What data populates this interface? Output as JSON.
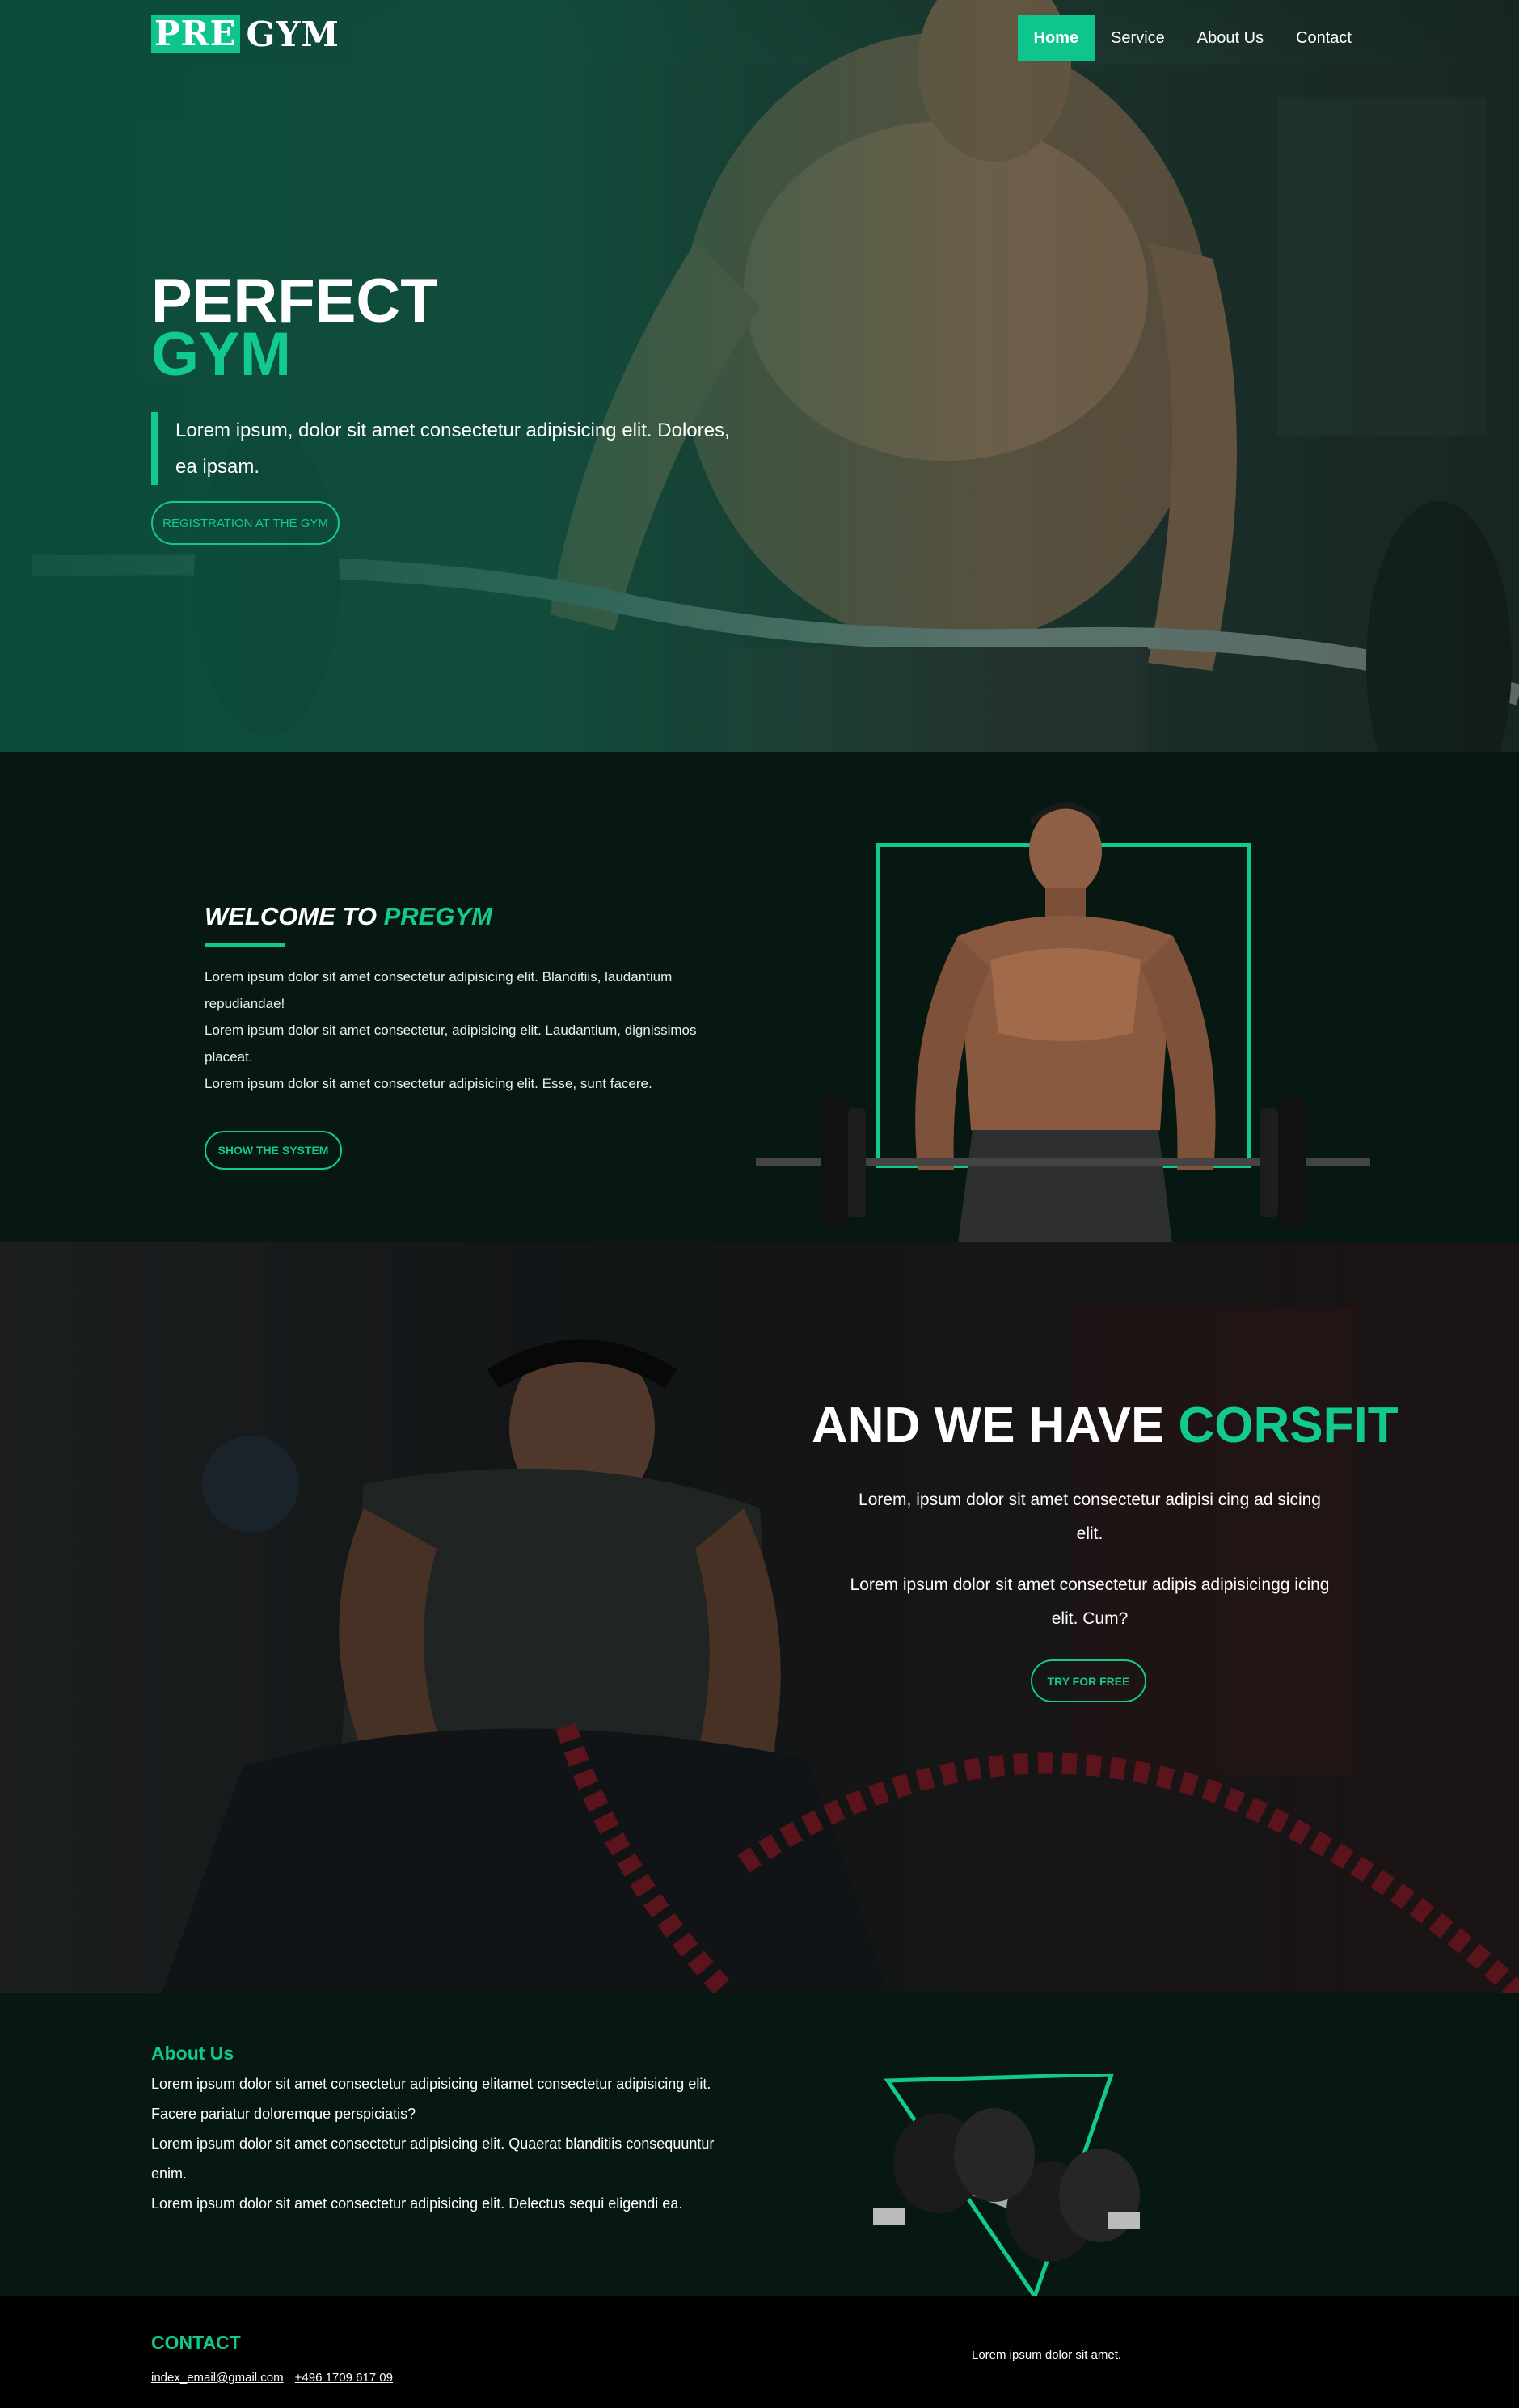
{
  "brand": {
    "logo_part1": "PRE",
    "logo_part2": "GYM"
  },
  "nav": {
    "home": "Home",
    "service": "Service",
    "about": "About Us",
    "contact": "Contact"
  },
  "hero": {
    "title_line1": "PERFECT",
    "title_line2": "GYM",
    "text": "Lorem ipsum, dolor sit amet consectetur adipisicing elit. Dolores, ea ipsam.",
    "button": "REGISTRATION AT THE GYM"
  },
  "welcome": {
    "title_prefix": "WELCOME TO ",
    "title_accent": "PREGYM",
    "line1": "Lorem ipsum dolor sit amet consectetur adipisicing elit. Blanditiis, laudantium repudiandae!",
    "line2": "Lorem ipsum dolor sit amet consectetur, adipisicing elit. Laudantium, dignissimos placeat.",
    "line3": "Lorem ipsum dolor sit amet consectetur adipisicing elit. Esse, sunt facere.",
    "button": "SHOW THE SYSTEM"
  },
  "crossfit": {
    "title_prefix": "AND WE HAVE ",
    "title_accent": "CORSFIT",
    "para1": "Lorem, ipsum dolor sit amet consectetur adipisi cing ad sicing elit.",
    "para2": "Lorem ipsum dolor sit amet consectetur adipis adipisicingg icing elit. Cum?",
    "button": "TRY FOR FREE"
  },
  "about": {
    "title": "About Us",
    "line1": "Lorem ipsum dolor sit amet consectetur adipisicing elitamet consectetur adipisicing elit. Facere pariatur doloremque perspiciatis?",
    "line2": "Lorem ipsum dolor sit amet consectetur adipisicing elit. Quaerat blanditiis consequuntur enim.",
    "line3": "Lorem ipsum dolor sit amet consectetur adipisicing elit. Delectus sequi eligendi ea."
  },
  "footer": {
    "title": "CONTACT",
    "email": "index_email@gmail.com",
    "phone": "+496 1709 617 09",
    "note": "Lorem ipsum dolor sit amet."
  },
  "colors": {
    "accent": "#12c98f",
    "dark_bg": "#071812",
    "footer_bg": "#000000"
  }
}
